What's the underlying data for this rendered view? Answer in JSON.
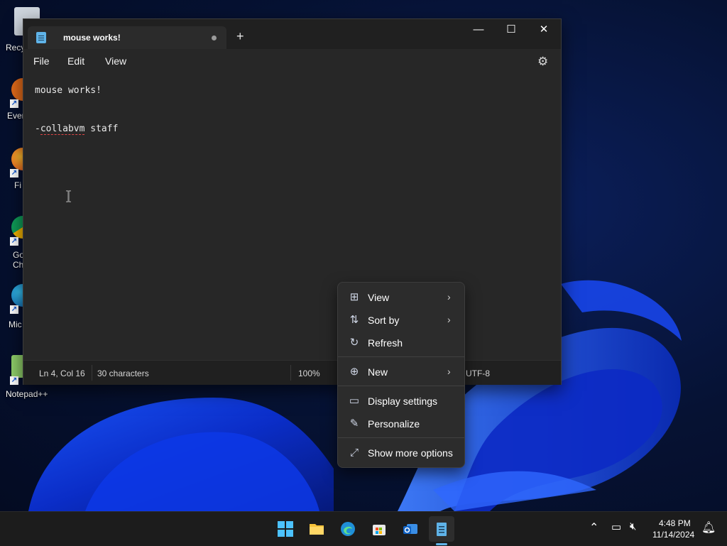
{
  "desktop": {
    "icons": [
      {
        "label": "Recy"
      },
      {
        "label": "Ever"
      },
      {
        "label": "Fi"
      },
      {
        "label": "Go Ch"
      },
      {
        "label": "Mic E"
      },
      {
        "label": "Notepad++"
      }
    ]
  },
  "notepad": {
    "tab_title": "mouse works!",
    "new_tab": "+",
    "window_buttons": {
      "minimize": "—",
      "maximize": "☐",
      "close": "✕"
    },
    "menu": {
      "file": "File",
      "edit": "Edit",
      "view": "View"
    },
    "settings_icon": "⚙",
    "content": {
      "line1": "mouse works!",
      "line4_prefix": "-",
      "line4_word": "collabvm",
      "line4_suffix": " staff"
    },
    "status": {
      "position": "Ln 4, Col 16",
      "characters": "30 characters",
      "zoom": "100%",
      "encoding": "UTF-8"
    }
  },
  "context_menu": {
    "items": [
      {
        "label": "View",
        "icon": "grid-icon"
      },
      {
        "label": "Sort by",
        "icon": "sort-icon"
      },
      {
        "label": "Refresh",
        "icon": "refresh-icon"
      },
      {
        "label": "New",
        "icon": "plus-circle-icon"
      },
      {
        "label": "Display settings",
        "icon": "display-icon"
      },
      {
        "label": "Personalize",
        "icon": "pen-icon"
      },
      {
        "label": "Show more options",
        "icon": "expand-icon"
      }
    ]
  },
  "taskbar": {
    "clock_time": "4:48 PM",
    "clock_date": "11/14/2024"
  },
  "colors": {
    "accent": "#5fb3e8",
    "window_bg": "#272727",
    "menu_bg": "#2c2c2c",
    "taskbar_bg": "#1c1c1c"
  }
}
